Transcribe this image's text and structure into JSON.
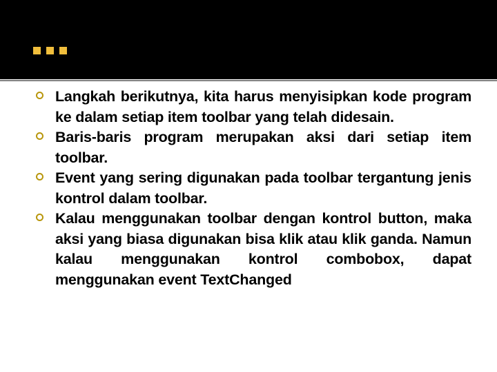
{
  "slide": {
    "title": "...",
    "title_dot_count": 3,
    "colors": {
      "header_background": "#000000",
      "title_dot": "#F0BE3C",
      "bullet_marker": "#B8960C",
      "body_text": "#000000",
      "rule": "#7F7F7F",
      "page_background": "#FFFFFF"
    },
    "bullets": [
      {
        "text": "Langkah berikutnya, kita harus menyisipkan kode program ke dalam setiap item toolbar yang telah didesain."
      },
      {
        "text": "Baris-baris program merupakan aksi dari setiap item toolbar."
      },
      {
        "text": "Event yang sering digunakan pada toolbar tergantung jenis kontrol dalam toolbar."
      },
      {
        "text": "Kalau menggunakan toolbar dengan kontrol button, maka aksi yang biasa digunakan bisa klik atau klik ganda. Namun kalau menggunakan kontrol combobox, dapat menggunakan event TextChanged"
      }
    ]
  }
}
